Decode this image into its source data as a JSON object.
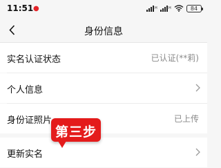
{
  "status_bar": {
    "time": "11:51",
    "notification_dot": "●",
    "battery_level": "84",
    "icons": [
      "cellular-signal-icon",
      "cellular-signal-icon",
      "wifi-icon",
      "battery-icon"
    ]
  },
  "nav": {
    "title": "身份信息",
    "back_icon": "chevron-left-icon"
  },
  "rows": [
    {
      "label": "实名认证状态",
      "value": "已认证(**莉)"
    },
    {
      "label": "个人信息",
      "value": ""
    },
    {
      "label": "身份证照片",
      "value": "已上传"
    },
    {
      "label": "更新实名",
      "value": ""
    }
  ],
  "overlay": {
    "step_label": "第三步",
    "color": "#e41b1b"
  },
  "colors": {
    "background": "#f6f6f6",
    "card": "#ffffff",
    "secondary_text": "#8a8a8a"
  }
}
